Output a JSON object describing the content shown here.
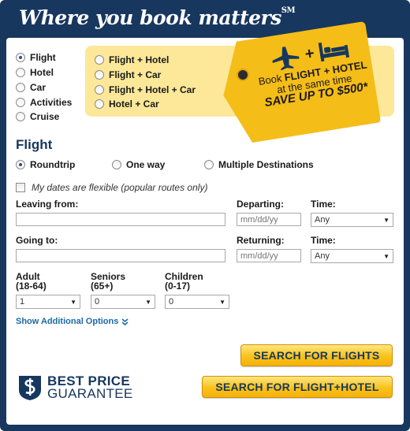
{
  "header": {
    "tagline": "Where you book matters",
    "tm": "SM"
  },
  "product_types": [
    {
      "label": "Flight",
      "selected": true
    },
    {
      "label": "Hotel",
      "selected": false
    },
    {
      "label": "Car",
      "selected": false
    },
    {
      "label": "Activities",
      "selected": false
    },
    {
      "label": "Cruise",
      "selected": false
    }
  ],
  "bundles": [
    {
      "label": "Flight + Hotel"
    },
    {
      "label": "Flight + Car"
    },
    {
      "label": "Flight + Hotel + Car"
    },
    {
      "label": "Hotel + Car"
    }
  ],
  "promo": {
    "line1_pre": "Book ",
    "line1_bold": "FLIGHT + HOTEL",
    "line2": "at the same time",
    "line3": "SAVE UP TO $500*",
    "plus": "+"
  },
  "flight": {
    "title": "Flight",
    "trip_types": [
      {
        "label": "Roundtrip",
        "selected": true
      },
      {
        "label": "One way",
        "selected": false
      },
      {
        "label": "Multiple Destinations",
        "selected": false
      }
    ],
    "flexible_label": "My dates are flexible (popular routes only)",
    "leaving_label": "Leaving from:",
    "going_label": "Going to:",
    "departing_label": "Departing:",
    "returning_label": "Returning:",
    "time_label": "Time:",
    "date_placeholder": "mm/dd/yy",
    "time_value": "Any",
    "travelers": [
      {
        "label": "Adult",
        "sub": "(18-64)",
        "value": "1"
      },
      {
        "label": "Seniors",
        "sub": "(65+)",
        "value": "0"
      },
      {
        "label": "Children",
        "sub": "(0-17)",
        "value": "0"
      }
    ],
    "show_options": "Show Additional Options"
  },
  "buttons": {
    "search_flights": "SEARCH FOR FLIGHTS",
    "search_flight_hotel": "SEARCH FOR FLIGHT+HOTEL"
  },
  "guarantee": {
    "line1": "BEST PRICE",
    "line2": "GUARANTEE"
  },
  "colors": {
    "navy": "#17375e",
    "gold": "#f5bd17",
    "promo_bg": "#fce898",
    "link": "#1a6aa8"
  }
}
